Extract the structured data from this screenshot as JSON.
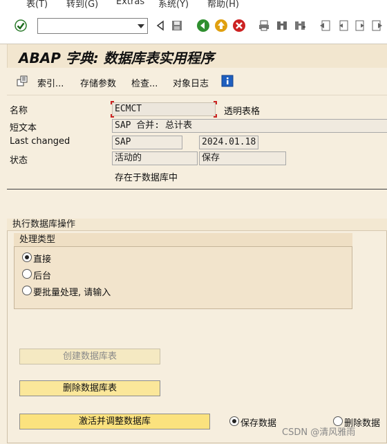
{
  "menu": {
    "items": [
      "表(T)",
      "转到(G)",
      "Extras",
      "系统(Y)",
      "帮助(H)"
    ]
  },
  "toolbar": {
    "command_value": "",
    "icons": [
      "enter-icon",
      "back-icon",
      "save-icon",
      "exit-icon",
      "cancel-icon",
      "print-icon",
      "find-icon",
      "find-next-icon",
      "first-page-icon",
      "prev-page-icon",
      "next-page-icon",
      "last-page-icon"
    ]
  },
  "title": "ABAP 字典: 数据库表实用程序",
  "app_toolbar": {
    "index": "索引...",
    "storage": "存储参数",
    "check": "检查...",
    "object_log": "对象日志"
  },
  "fields": {
    "name_label": "名称",
    "name_value": "ECMCT",
    "name_type": "透明表格",
    "short_text_label": "短文本",
    "short_text_value": "SAP 合并: 总计表",
    "last_changed_label": "Last changed",
    "last_changed_user": "SAP",
    "last_changed_date": "2024.01.18",
    "status_label": "状态",
    "status_value1": "活动的",
    "status_value2": "保存",
    "exists_text": "存在于数据库中"
  },
  "group": {
    "title": "执行数据库操作",
    "sub_title": "处理类型",
    "options": [
      "直接",
      "后台",
      "要批量处理, 请输入"
    ],
    "selected": 0
  },
  "buttons": {
    "create": "创建数据库表",
    "delete": "删除数据库表",
    "activate": "激活并调整数据库"
  },
  "data_options": {
    "save": "保存数据",
    "delete": "删除数据",
    "selected": 0
  },
  "watermark": "CSDN @清风雅雨",
  "colors": {
    "background": "#f6eede",
    "button": "#fbe79a",
    "required_corner": "#cc2222"
  }
}
